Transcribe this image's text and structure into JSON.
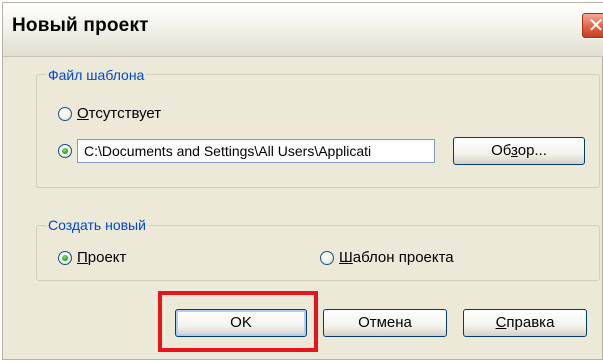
{
  "dialog": {
    "title": "Новый проект",
    "close_icon": "close-icon"
  },
  "template_group": {
    "legend": "Файл шаблона",
    "option_none": {
      "label_first": "О",
      "label_rest": "тсутствует",
      "checked": false
    },
    "option_file": {
      "checked": true,
      "path_value": "C:\\Documents and Settings\\All Users\\Applicati"
    },
    "browse_button": {
      "label_pre": "Об",
      "label_ul": "з",
      "label_post": "ор..."
    }
  },
  "create_group": {
    "legend": "Создать новый",
    "option_project": {
      "label_first": "П",
      "label_rest": "роект",
      "checked": true
    },
    "option_template": {
      "label_first": "Ш",
      "label_rest": "аблон проекта",
      "checked": false
    }
  },
  "buttons": {
    "ok": "OK",
    "cancel": "Отмена",
    "help_first": "С",
    "help_rest": "правка"
  },
  "annotation": {
    "highlight_color": "#e8141c"
  }
}
